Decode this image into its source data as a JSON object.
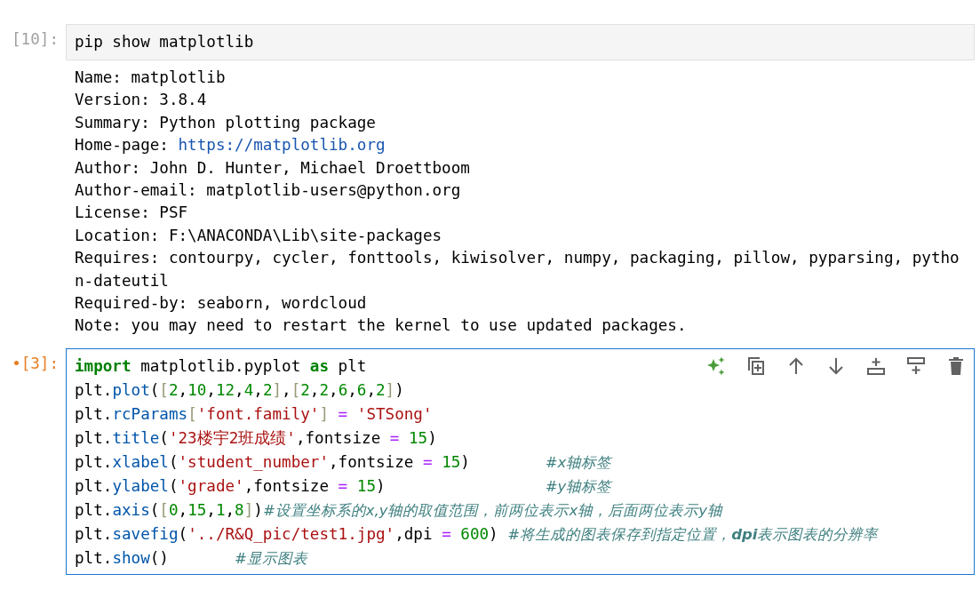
{
  "cells": [
    {
      "prompt": "[10]:",
      "modified": false,
      "active": false,
      "lines": [
        [
          {
            "kind": "plain",
            "text": "pip show matplotlib"
          }
        ]
      ],
      "output": [
        {
          "kind": "text",
          "text": "Name: matplotlib"
        },
        {
          "kind": "text",
          "text": "Version: 3.8.4"
        },
        {
          "kind": "text",
          "text": "Summary: Python plotting package"
        },
        {
          "kind": "link",
          "text": "Home-page: ",
          "link": "https://matplotlib.org"
        },
        {
          "kind": "text",
          "text": "Author: John D. Hunter, Michael Droettboom"
        },
        {
          "kind": "text",
          "text": "Author-email: matplotlib-users@python.org"
        },
        {
          "kind": "text",
          "text": "License: PSF"
        },
        {
          "kind": "text",
          "text": "Location: F:\\ANACONDA\\Lib\\site-packages"
        },
        {
          "kind": "text",
          "text": "Requires: contourpy, cycler, fonttools, kiwisolver, numpy, packaging, pillow, pyparsing, pytho"
        },
        {
          "kind": "text",
          "text": "n-dateutil"
        },
        {
          "kind": "text",
          "text": "Required-by: seaborn, wordcloud"
        },
        {
          "kind": "text",
          "text": "Note: you may need to restart the kernel to use updated packages."
        }
      ]
    },
    {
      "prompt": "[3]:",
      "modified": true,
      "active": true,
      "lines": [
        [
          {
            "kind": "kw",
            "text": "import"
          },
          {
            "kind": "plain",
            "text": " matplotlib.pyplot "
          },
          {
            "kind": "kw",
            "text": "as"
          },
          {
            "kind": "plain",
            "text": " plt"
          }
        ],
        [
          {
            "kind": "plain",
            "text": "plt."
          },
          {
            "kind": "prop",
            "text": "plot"
          },
          {
            "kind": "plain",
            "text": "("
          },
          {
            "kind": "br",
            "text": "["
          },
          {
            "kind": "num",
            "text": "2"
          },
          {
            "kind": "plain",
            "text": ","
          },
          {
            "kind": "num",
            "text": "10"
          },
          {
            "kind": "plain",
            "text": ","
          },
          {
            "kind": "num",
            "text": "12"
          },
          {
            "kind": "plain",
            "text": ","
          },
          {
            "kind": "num",
            "text": "4"
          },
          {
            "kind": "plain",
            "text": ","
          },
          {
            "kind": "num",
            "text": "2"
          },
          {
            "kind": "br",
            "text": "]"
          },
          {
            "kind": "plain",
            "text": ","
          },
          {
            "kind": "br",
            "text": "["
          },
          {
            "kind": "num",
            "text": "2"
          },
          {
            "kind": "plain",
            "text": ","
          },
          {
            "kind": "num",
            "text": "2"
          },
          {
            "kind": "plain",
            "text": ","
          },
          {
            "kind": "num",
            "text": "6"
          },
          {
            "kind": "plain",
            "text": ","
          },
          {
            "kind": "num",
            "text": "6"
          },
          {
            "kind": "plain",
            "text": ","
          },
          {
            "kind": "num",
            "text": "2"
          },
          {
            "kind": "br",
            "text": "]"
          },
          {
            "kind": "plain",
            "text": ")"
          }
        ],
        [
          {
            "kind": "plain",
            "text": "plt."
          },
          {
            "kind": "prop",
            "text": "rcParams"
          },
          {
            "kind": "br",
            "text": "["
          },
          {
            "kind": "str",
            "text": "'font.family'"
          },
          {
            "kind": "br",
            "text": "]"
          },
          {
            "kind": "op",
            "text": " = "
          },
          {
            "kind": "str",
            "text": "'STSong'"
          }
        ],
        [
          {
            "kind": "plain",
            "text": "plt."
          },
          {
            "kind": "prop",
            "text": "title"
          },
          {
            "kind": "plain",
            "text": "("
          },
          {
            "kind": "str",
            "text": "'23楼宇2班成绩'"
          },
          {
            "kind": "plain",
            "text": ",fontsize"
          },
          {
            "kind": "op",
            "text": " = "
          },
          {
            "kind": "num",
            "text": "15"
          },
          {
            "kind": "plain",
            "text": ")"
          }
        ],
        [
          {
            "kind": "plain",
            "text": "plt."
          },
          {
            "kind": "prop",
            "text": "xlabel"
          },
          {
            "kind": "plain",
            "text": "("
          },
          {
            "kind": "str",
            "text": "'student_number'"
          },
          {
            "kind": "plain",
            "text": ",fontsize"
          },
          {
            "kind": "op",
            "text": " = "
          },
          {
            "kind": "num",
            "text": "15"
          },
          {
            "kind": "plain",
            "text": ")        "
          },
          {
            "kind": "com",
            "text": "#x轴标签"
          }
        ],
        [
          {
            "kind": "plain",
            "text": "plt."
          },
          {
            "kind": "prop",
            "text": "ylabel"
          },
          {
            "kind": "plain",
            "text": "("
          },
          {
            "kind": "str",
            "text": "'grade'"
          },
          {
            "kind": "plain",
            "text": ",fontsize"
          },
          {
            "kind": "op",
            "text": " = "
          },
          {
            "kind": "num",
            "text": "15"
          },
          {
            "kind": "plain",
            "text": ")                 "
          },
          {
            "kind": "com",
            "text": "#y轴标签"
          }
        ],
        [
          {
            "kind": "plain",
            "text": "plt."
          },
          {
            "kind": "prop",
            "text": "axis"
          },
          {
            "kind": "plain",
            "text": "("
          },
          {
            "kind": "br",
            "text": "["
          },
          {
            "kind": "num",
            "text": "0"
          },
          {
            "kind": "plain",
            "text": ","
          },
          {
            "kind": "num",
            "text": "15"
          },
          {
            "kind": "plain",
            "text": ","
          },
          {
            "kind": "num",
            "text": "1"
          },
          {
            "kind": "plain",
            "text": ","
          },
          {
            "kind": "num",
            "text": "8"
          },
          {
            "kind": "br",
            "text": "]"
          },
          {
            "kind": "plain",
            "text": ")"
          },
          {
            "kind": "com",
            "text": "#设置坐标系的x,y轴的取值范围，前两位表示x轴，后面两位表示y轴"
          }
        ],
        [
          {
            "kind": "plain",
            "text": "plt."
          },
          {
            "kind": "prop",
            "text": "savefig"
          },
          {
            "kind": "plain",
            "text": "("
          },
          {
            "kind": "str",
            "text": "'../R&Q_pic/test1.jpg'"
          },
          {
            "kind": "plain",
            "text": ",dpi"
          },
          {
            "kind": "op",
            "text": " = "
          },
          {
            "kind": "num",
            "text": "600"
          },
          {
            "kind": "plain",
            "text": ") "
          },
          {
            "kind": "com",
            "text": "#将生成的图表保存到指定位置，**dpi**表示图表的分辨率"
          }
        ],
        [
          {
            "kind": "plain",
            "text": "plt."
          },
          {
            "kind": "prop",
            "text": "show"
          },
          {
            "kind": "plain",
            "text": "()       "
          },
          {
            "kind": "com",
            "text": "#显示图表"
          }
        ]
      ]
    }
  ]
}
